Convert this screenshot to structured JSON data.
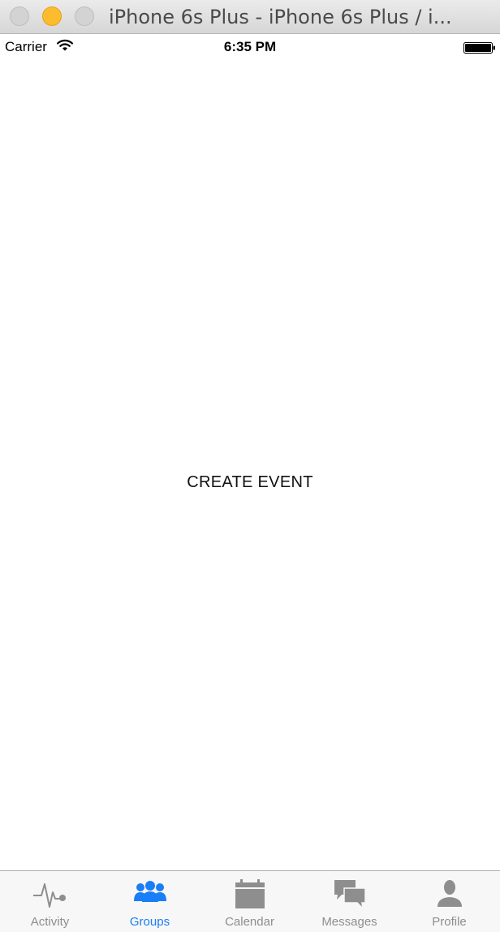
{
  "window": {
    "title": "iPhone 6s Plus - iPhone 6s Plus / i..."
  },
  "status_bar": {
    "carrier": "Carrier",
    "time": "6:35 PM"
  },
  "main": {
    "label": "CREATE EVENT"
  },
  "tab_bar": {
    "active_color": "#1a7ef6",
    "inactive_color": "#8e8e8e",
    "tabs": [
      {
        "label": "Activity",
        "icon": "activity-icon",
        "active": false
      },
      {
        "label": "Groups",
        "icon": "groups-icon",
        "active": true
      },
      {
        "label": "Calendar",
        "icon": "calendar-icon",
        "active": false
      },
      {
        "label": "Messages",
        "icon": "messages-icon",
        "active": false
      },
      {
        "label": "Profile",
        "icon": "profile-icon",
        "active": false
      }
    ]
  }
}
